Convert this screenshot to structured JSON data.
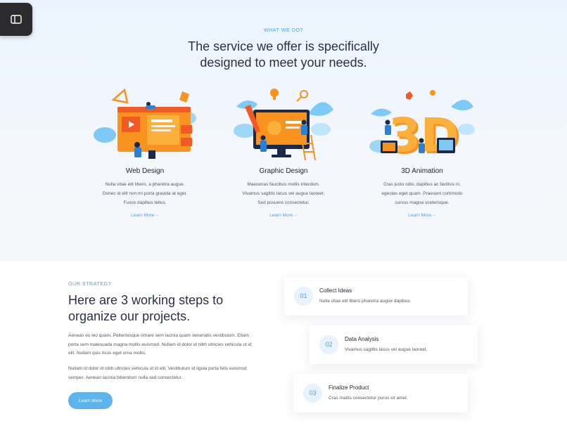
{
  "services": {
    "eyebrow": "WHAT WE DO?",
    "title_line1": "The service we offer is specifically",
    "title_line2": "designed to meet your needs.",
    "items": [
      {
        "title": "Web Design",
        "lines": [
          "Nulla vitae elit libero, a pharetra augue.",
          "Donec id elit non mi porta gravida at eget.",
          "Fusce dapibus tellus."
        ],
        "link": "Learn More",
        "icon": "web-design-illustration"
      },
      {
        "title": "Graphic Design",
        "lines": [
          "Maecenas faucibus mollis interdum.",
          "Vivamus sagittis lacus vel augue laoreet.",
          "Sed posuere consectetur."
        ],
        "link": "Learn More",
        "icon": "graphic-design-illustration"
      },
      {
        "title": "3D Animation",
        "lines": [
          "Cras justo odio, dapibus ac facilisis in,",
          "egestas eget quam. Praesent commodo",
          "cursus magna scelerisque."
        ],
        "link": "Learn More",
        "icon": "3d-animation-illustration"
      }
    ]
  },
  "strategy": {
    "eyebrow": "OUR STRATEGY",
    "title_line1": "Here are 3 working steps to",
    "title_line2": "organize our projects.",
    "paragraph1": "Aenean eu leo quam. Pellentesque ornare sem lacinia quam venenatis vestibulum. Etiam porta sem malesuada magna mollis euismod. Nullam id dolor id nibh ultricies vehicula ut id elit. Nullam quis risus eget urna mollis.",
    "paragraph2": "Nullam id dolor id nibh ultricies vehicula ut id elit. Vestibulum id ligula porta felis euismod semper. Aenean lacinia bibendum nulla sed consectetur.",
    "button": "Learn More",
    "steps": [
      {
        "num": "01",
        "title": "Collect Ideas",
        "desc": "Nulla vitae elit libero pharetra augue dapibus."
      },
      {
        "num": "02",
        "title": "Data Analysis",
        "desc": "Vivamus sagittis lacus vel augue laoreet."
      },
      {
        "num": "03",
        "title": "Finalize Product",
        "desc": "Cras mattis consectetur purus sit amet."
      }
    ]
  },
  "colors": {
    "accent": "#4aa3e3",
    "button": "#5bb4ec",
    "orange": "#f7931e",
    "heading": "#2b2f45"
  },
  "icons": {
    "sidebar_toggle": "sidebar-toggle-icon",
    "link_arrow": "arrow-right-icon"
  }
}
